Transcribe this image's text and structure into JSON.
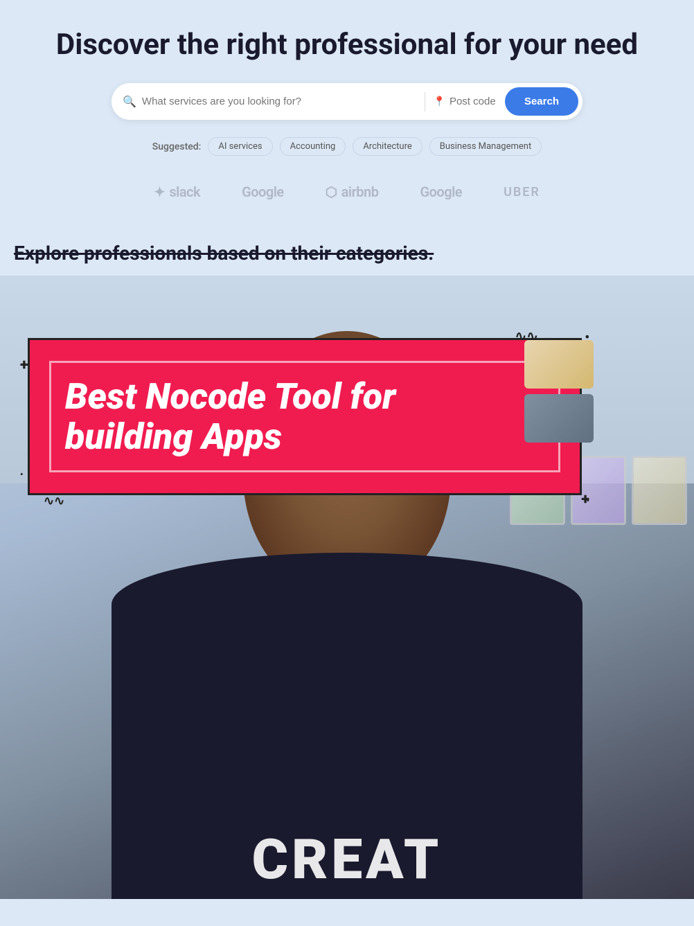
{
  "hero": {
    "title": "Discover the right professional for your need"
  },
  "search": {
    "service_placeholder": "What services are you looking for?",
    "location_placeholder": "Post code",
    "button_label": "Search"
  },
  "suggested": {
    "label": "Suggested:",
    "tags": [
      "AI services",
      "Accounting",
      "Architecture",
      "Business Management"
    ]
  },
  "brands": [
    {
      "name": "slack",
      "display": "slack",
      "icon": "✦"
    },
    {
      "name": "google",
      "display": "Google",
      "icon": ""
    },
    {
      "name": "airbnb",
      "display": "airbnb",
      "icon": "⬡"
    },
    {
      "name": "google2",
      "display": "Google",
      "icon": ""
    },
    {
      "name": "uber",
      "display": "UBER",
      "icon": ""
    }
  ],
  "explore": {
    "title": "Explore professionals based on their categories."
  },
  "nocode_promo": {
    "line1": "Best Nocode Tool for",
    "line2": "building Apps"
  },
  "bottom_text": "CREAT"
}
